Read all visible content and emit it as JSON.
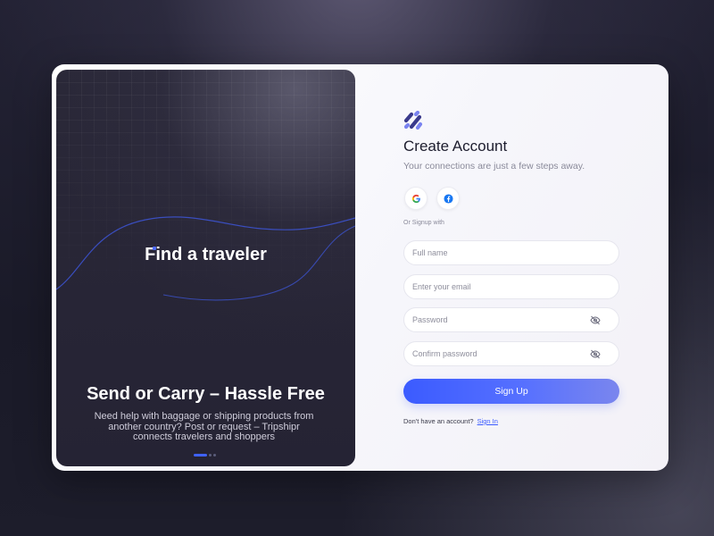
{
  "hero": {
    "tagline": "Find a traveler",
    "title": "Send or Carry – Hassle Free",
    "description": "Need help with baggage or shipping products from another country? Post or request – Tripshipr connects travelers and shoppers",
    "carousel": {
      "slide_count": 3,
      "active_index": 0
    }
  },
  "form": {
    "logo_icon": "tripshipr-logo-icon",
    "title": "Create Account",
    "subtitle": "Your connections are just a few steps away.",
    "social": [
      {
        "name": "google-icon"
      },
      {
        "name": "facebook-icon"
      }
    ],
    "or_signup_label": "Or Signup with",
    "fields": {
      "full_name": {
        "placeholder": "Full name",
        "value": ""
      },
      "email": {
        "placeholder": "Enter your email",
        "value": ""
      },
      "password": {
        "placeholder": "Password",
        "value": "",
        "icon": "eye-off-icon"
      },
      "confirm_password": {
        "placeholder": "Confirm password",
        "value": "",
        "icon": "eye-off-icon"
      }
    },
    "signup_button": "Sign Up",
    "footer_text": "Don't have an account?",
    "signin_link": "Sign In"
  },
  "colors": {
    "accent": "#3b5bff",
    "hero_bg": "#262435",
    "page_bg": "#1c1c2a"
  }
}
